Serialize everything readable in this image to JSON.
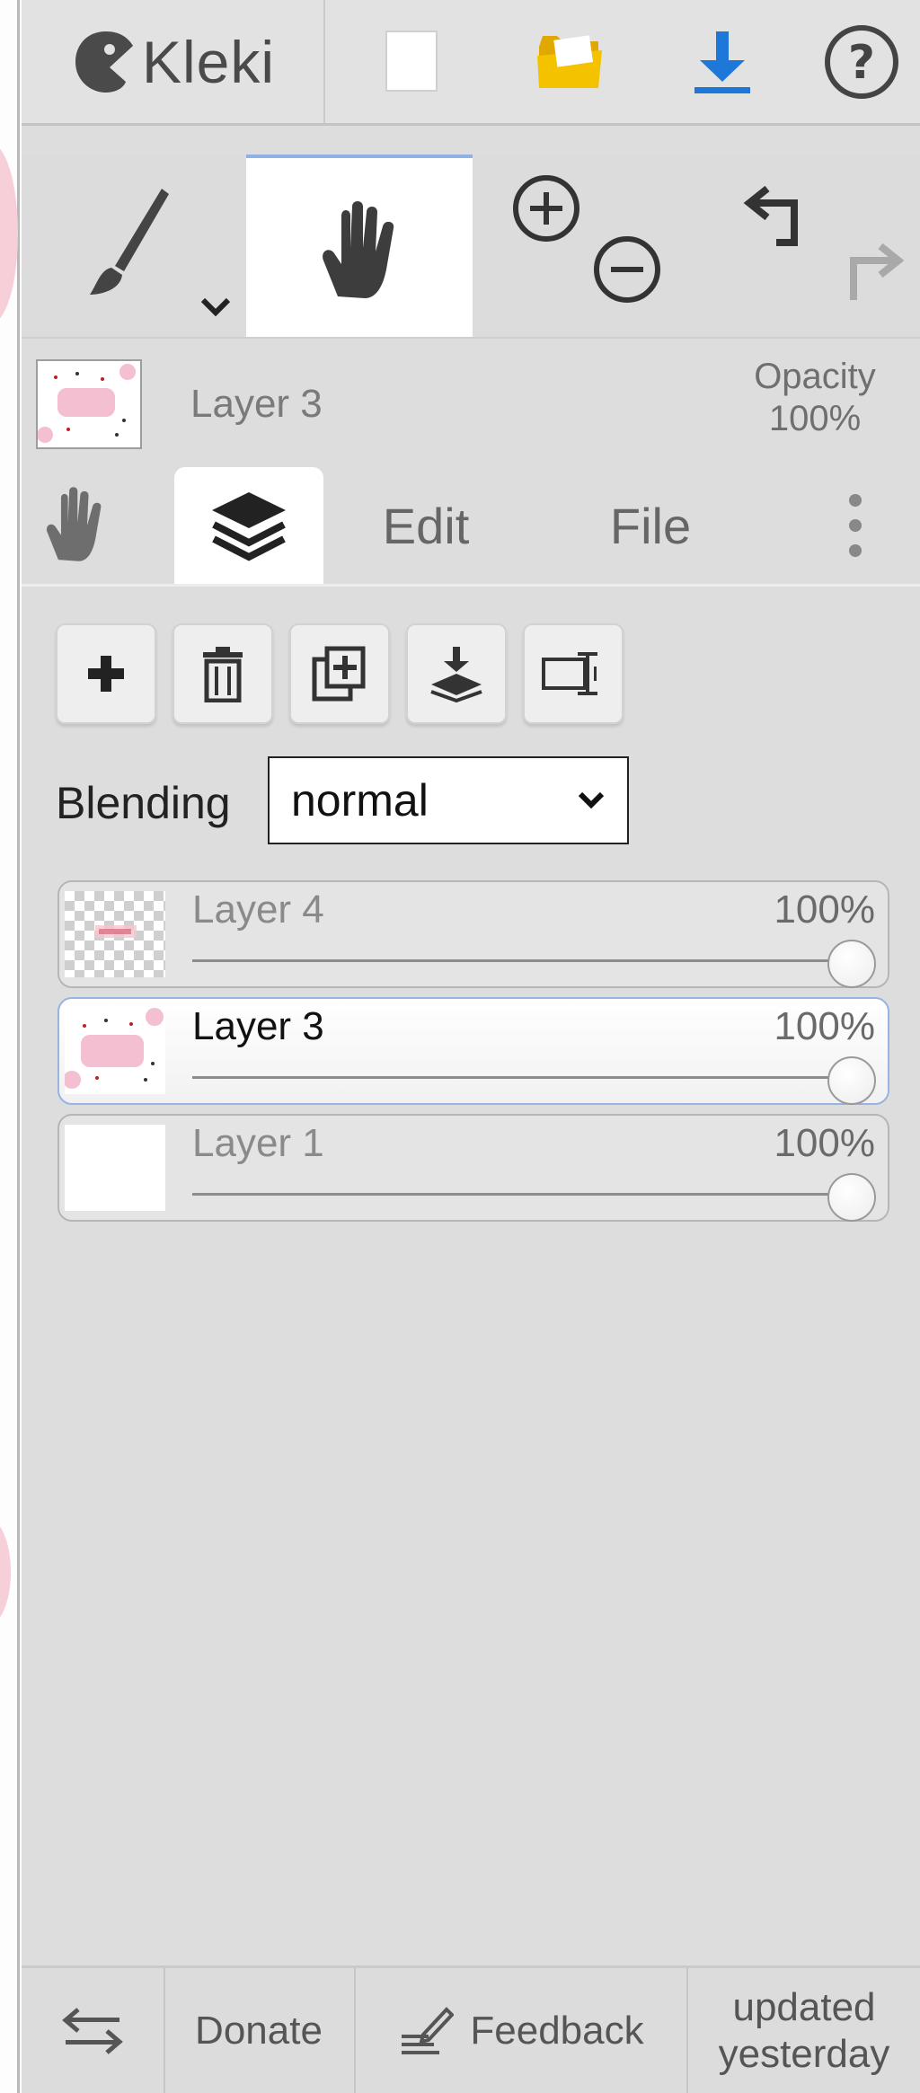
{
  "app": {
    "title": "Kleki"
  },
  "topbar": {
    "new_icon": "new-file-icon",
    "open_icon": "open-folder-icon",
    "save_icon": "download-icon",
    "help_icon": "help-icon",
    "colors": {
      "folder": "#f5c200",
      "download": "#1e78d9"
    }
  },
  "tools": {
    "active": "hand",
    "brush_icon": "brush-icon",
    "hand_icon": "hand-icon",
    "zoom_in_icon": "zoom-in-icon",
    "zoom_out_icon": "zoom-out-icon",
    "undo_icon": "undo-icon",
    "redo_icon": "redo-icon"
  },
  "current_layer": {
    "name": "Layer 3",
    "opacity_label": "Opacity",
    "opacity_value": "100%"
  },
  "tabs": [
    {
      "id": "hand",
      "label": "",
      "icon": "hand-icon"
    },
    {
      "id": "layers",
      "label": "",
      "icon": "layers-icon",
      "active": true
    },
    {
      "id": "edit",
      "label": "Edit"
    },
    {
      "id": "file",
      "label": "File"
    },
    {
      "id": "more",
      "label": "",
      "icon": "more-vertical-icon"
    }
  ],
  "layer_actions": [
    "add-layer",
    "delete-layer",
    "duplicate-layer",
    "merge-down",
    "rename-layer"
  ],
  "blending": {
    "label": "Blending",
    "value": "normal"
  },
  "layers": [
    {
      "name": "Layer 4",
      "opacity": "100%",
      "opacity_fraction": 1.0,
      "selected": false
    },
    {
      "name": "Layer 3",
      "opacity": "100%",
      "opacity_fraction": 1.0,
      "selected": true
    },
    {
      "name": "Layer 1",
      "opacity": "100%",
      "opacity_fraction": 1.0,
      "selected": false
    }
  ],
  "footer": {
    "swap_icon": "swap-arrows-icon",
    "donate": "Donate",
    "feedback": "Feedback",
    "updated_line1": "updated",
    "updated_line2": "yesterday"
  }
}
